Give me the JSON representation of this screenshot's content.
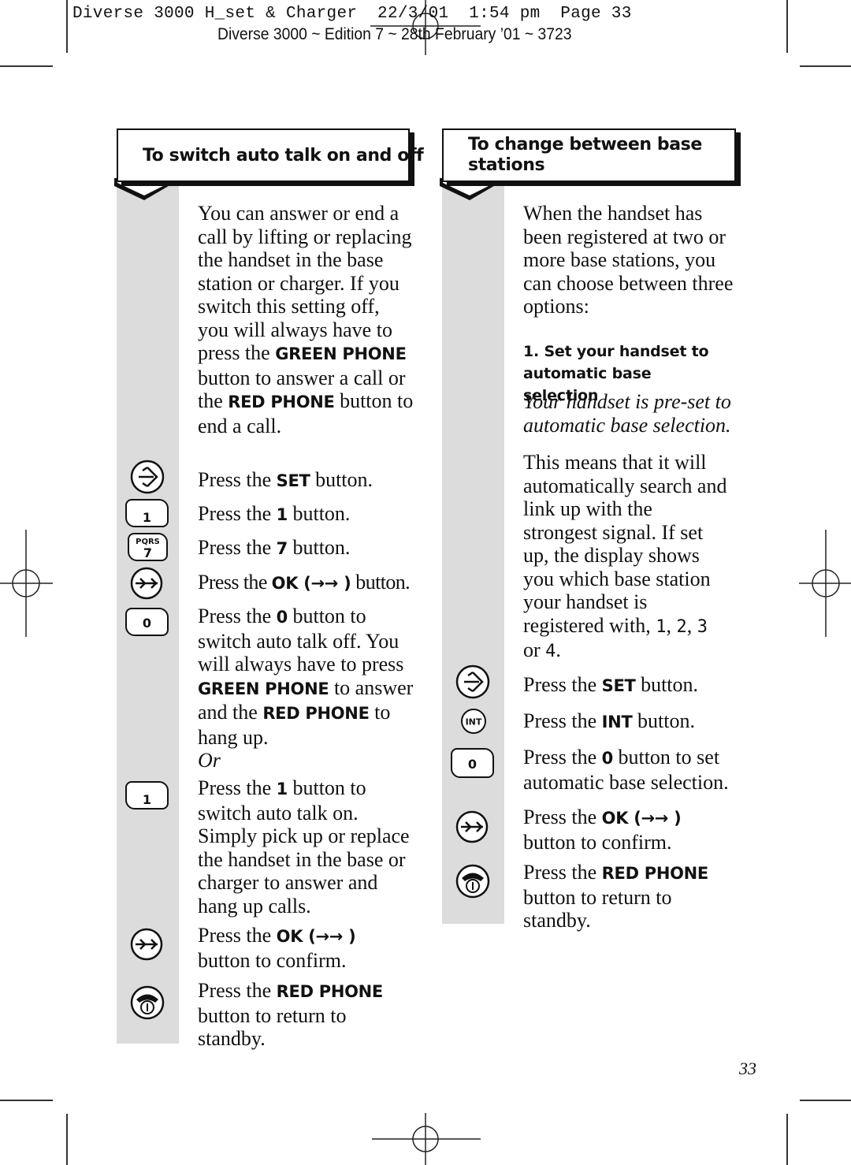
{
  "print_header": {
    "slug_line": "Diverse 3000 H_set & Charger  22/3/01  1:54 pm  Page 33",
    "edition_line": "Diverse 3000 ~ Edition 7 ~ 28th February ’01 ~ 3723"
  },
  "left_section": {
    "title": "To switch auto talk on and off",
    "intro": {
      "p1": "You can answer or end a call by lifting or replacing the handset in the base station or charger. If you switch this setting off, you will always have to press the",
      "b1": "GREEN PHONE",
      "p2": " button to answer a call or the ",
      "b2": "RED PHONE",
      "p3": " button to end a call."
    },
    "steps": [
      {
        "icon": "set-button-icon",
        "pre": "Press the ",
        "bold": "SET",
        "post": " button."
      },
      {
        "icon": "key-1-icon",
        "key_label": "1",
        "pre": "Press the ",
        "bold": "1",
        "post": " button."
      },
      {
        "icon": "key-7-pqrs-icon",
        "key_label": "7",
        "key_sub": "PQRS",
        "pre": "Press the ",
        "bold": "7",
        "post": " button."
      },
      {
        "icon": "ok-button-icon",
        "pre": "Press the ",
        "bold": "OK (→→ )",
        "post": " button."
      },
      {
        "icon": "key-0-icon",
        "key_label": "0",
        "pre": "Press the ",
        "bold": "0",
        "post": " button to switch auto talk off. You will always have to press ",
        "bold2": "GREEN PHONE",
        "mid2": " to answer and the ",
        "bold3": "RED PHONE",
        "post3": " to hang up."
      },
      {
        "or_label": "Or"
      },
      {
        "icon": "key-1-icon",
        "key_label": "1",
        "pre": "Press the ",
        "bold": "1",
        "post": " button to switch auto talk on. Simply pick up or replace the handset in the base or charger to answer and hang up calls."
      },
      {
        "icon": "ok-button-icon",
        "pre": "Press the ",
        "bold": "OK (→→ )",
        "post": " button to confirm."
      },
      {
        "icon": "red-phone-icon",
        "pre": "Press the ",
        "bold": "RED PHONE",
        "post": " button to return to standby."
      }
    ]
  },
  "right_section": {
    "title": "To change between base stations",
    "intro": "When the handset has been registered at two or more base stations, you can choose between three options:",
    "subheading": "1. Set your handset to automatic base selection",
    "italic_note": "Your handset is pre-set to automatic base selection.",
    "body": {
      "p1": "This means that it will automatically search and link up with the strongest signal. If set up, the display shows you which base station your handset is registered with, ",
      "d1": "1",
      "d2": "2",
      "d3": "3",
      "or_word": " or ",
      "d4": "4"
    },
    "steps": [
      {
        "icon": "set-button-icon",
        "pre": "Press the ",
        "bold": "SET",
        "post": " button."
      },
      {
        "icon": "int-button-icon",
        "icon_label": "INT",
        "pre": "Press the ",
        "bold": "INT",
        "post": " button."
      },
      {
        "icon": "key-0-icon",
        "key_label": "0",
        "pre": "Press the ",
        "bold": "0",
        "post": " button to set automatic base selection."
      },
      {
        "icon": "ok-button-icon",
        "pre": "Press the ",
        "bold": "OK (→→ )",
        "post": " button to confirm."
      },
      {
        "icon": "red-phone-icon",
        "pre": "Press the ",
        "bold": "RED PHONE",
        "post": " button to return to standby."
      }
    ]
  },
  "page_number": "33"
}
